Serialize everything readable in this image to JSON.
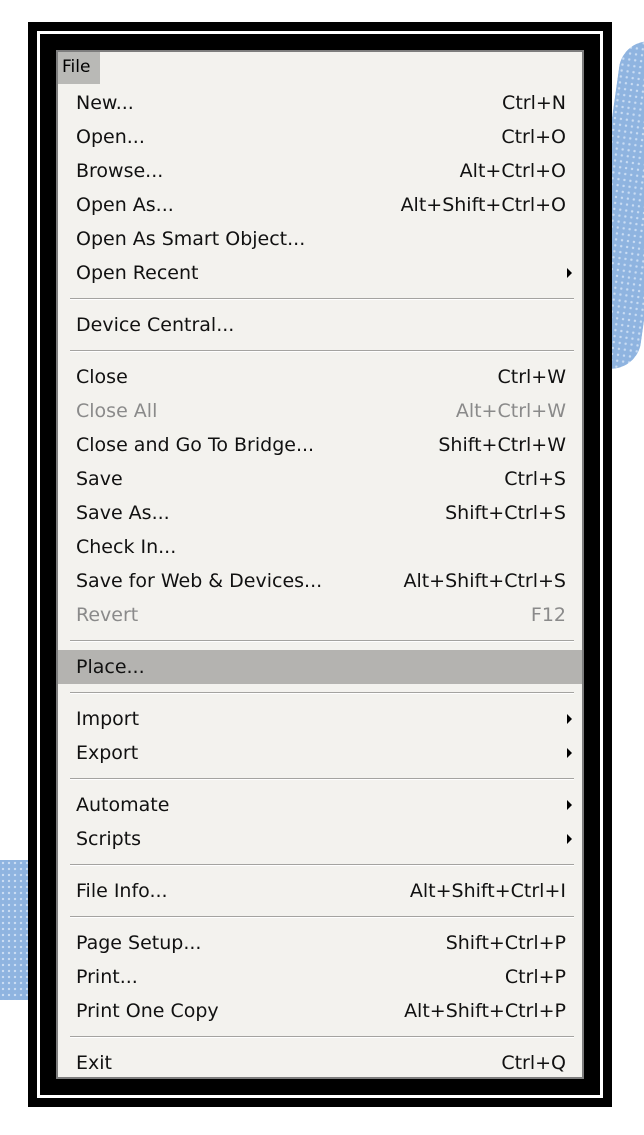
{
  "menu": {
    "title": "File",
    "groups": [
      [
        {
          "label": "New...",
          "shortcut": "Ctrl+N"
        },
        {
          "label": "Open...",
          "shortcut": "Ctrl+O"
        },
        {
          "label": "Browse...",
          "shortcut": "Alt+Ctrl+O"
        },
        {
          "label": "Open As...",
          "shortcut": "Alt+Shift+Ctrl+O"
        },
        {
          "label": "Open As Smart Object...",
          "shortcut": ""
        },
        {
          "label": "Open Recent",
          "shortcut": "",
          "submenu": true
        }
      ],
      [
        {
          "label": "Device Central...",
          "shortcut": ""
        }
      ],
      [
        {
          "label": "Close",
          "shortcut": "Ctrl+W"
        },
        {
          "label": "Close All",
          "shortcut": "Alt+Ctrl+W",
          "disabled": true
        },
        {
          "label": "Close and Go To Bridge...",
          "shortcut": "Shift+Ctrl+W"
        },
        {
          "label": "Save",
          "shortcut": "Ctrl+S"
        },
        {
          "label": "Save As...",
          "shortcut": "Shift+Ctrl+S"
        },
        {
          "label": "Check In...",
          "shortcut": ""
        },
        {
          "label": "Save for Web & Devices...",
          "shortcut": "Alt+Shift+Ctrl+S"
        },
        {
          "label": "Revert",
          "shortcut": "F12",
          "disabled": true
        }
      ],
      [
        {
          "label": "Place...",
          "shortcut": "",
          "highlighted": true
        }
      ],
      [
        {
          "label": "Import",
          "shortcut": "",
          "submenu": true
        },
        {
          "label": "Export",
          "shortcut": "",
          "submenu": true
        }
      ],
      [
        {
          "label": "Automate",
          "shortcut": "",
          "submenu": true
        },
        {
          "label": "Scripts",
          "shortcut": "",
          "submenu": true
        }
      ],
      [
        {
          "label": "File Info...",
          "shortcut": "Alt+Shift+Ctrl+I"
        }
      ],
      [
        {
          "label": "Page Setup...",
          "shortcut": "Shift+Ctrl+P"
        },
        {
          "label": "Print...",
          "shortcut": "Ctrl+P"
        },
        {
          "label": "Print One Copy",
          "shortcut": "Alt+Shift+Ctrl+P"
        }
      ],
      [
        {
          "label": "Exit",
          "shortcut": "Ctrl+Q"
        }
      ]
    ]
  }
}
